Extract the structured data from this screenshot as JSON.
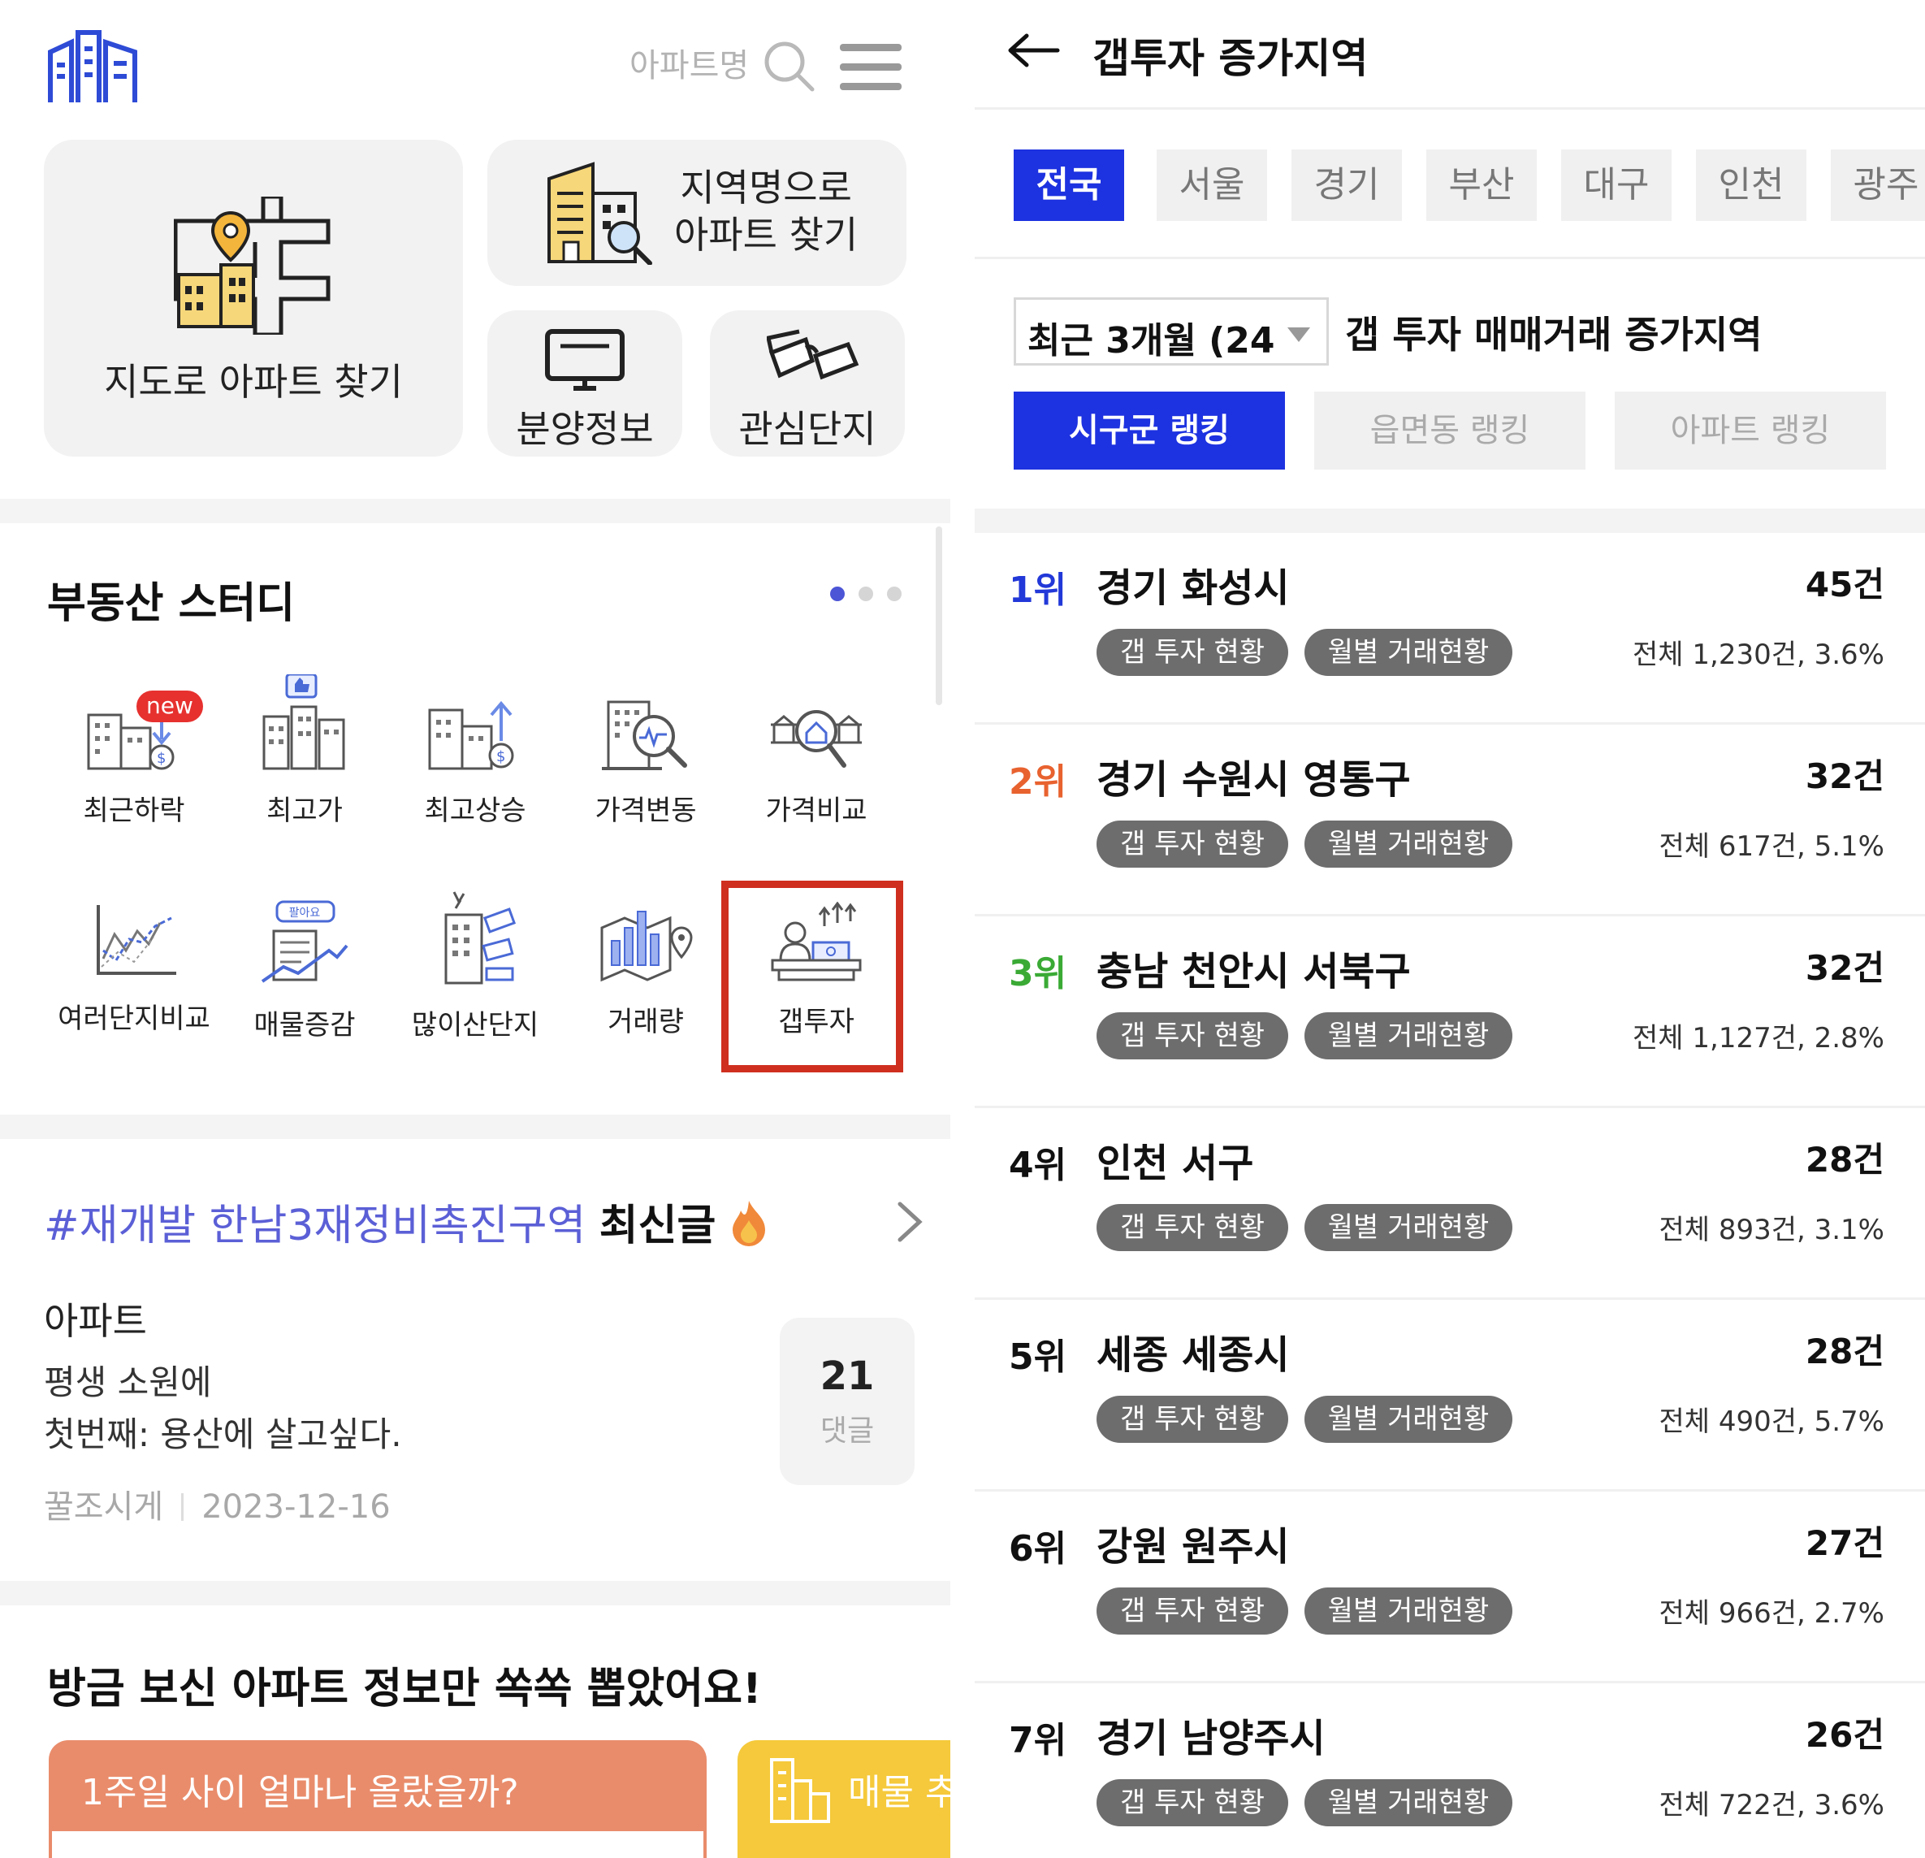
{
  "left": {
    "header": {
      "search_label": "아파트명"
    },
    "cards": {
      "map_label": "지도로 아파트 찾기",
      "region_label_1": "지역명으로",
      "region_label_2": "아파트 찾기",
      "sale_label": "분양정보",
      "favorite_label": "관심단지"
    },
    "study": {
      "title": "부동산 스터디",
      "new_badge": "new",
      "items": [
        {
          "label": "최근하락",
          "icon": "building-dollar-down-icon"
        },
        {
          "label": "최고가",
          "icon": "building-thumbs-up-icon"
        },
        {
          "label": "최고상승",
          "icon": "building-dollar-up-icon"
        },
        {
          "label": "가격변동",
          "icon": "building-magnifier-icon"
        },
        {
          "label": "가격비교",
          "icon": "house-compare-icon"
        },
        {
          "label": "여러단지비교",
          "icon": "line-chart-icon"
        },
        {
          "label": "매물증감",
          "icon": "listing-trend-icon"
        },
        {
          "label": "많이산단지",
          "icon": "building-money-icon"
        },
        {
          "label": "거래량",
          "icon": "map-bar-chart-icon"
        },
        {
          "label": "갭투자",
          "icon": "investor-desk-icon"
        }
      ],
      "badge_small": "팔아요"
    },
    "post": {
      "tag": "#재개발 한남3재정비촉진구역",
      "tag_suffix": "최신글",
      "category": "아파트",
      "line1": "평생 소원에",
      "line2": "첫번째: 용산에 살고싶다.",
      "author": "꿀조시게",
      "date": "2023-12-16",
      "comment_count": "21",
      "comment_label": "댓글"
    },
    "extract": {
      "title": "방금 보신 아파트 정보만 쏙쏙 뽑았어요!",
      "promo1": "1주일 사이 얼마나 올랐을까?",
      "promo2": "매물 추"
    }
  },
  "right": {
    "title": "갭투자 증가지역",
    "tabs": [
      "전국",
      "서울",
      "경기",
      "부산",
      "대구",
      "인천",
      "광주"
    ],
    "active_tab": "전국",
    "period_value": "최근 3개월 (24",
    "period_title": "갭 투자 매매거래 증가지역",
    "ranking_buttons": [
      "시구군 랭킹",
      "읍면동 랭킹",
      "아파트 랭킹"
    ],
    "chip_labels": {
      "gap": "갭 투자 현황",
      "monthly": "월별 거래현황"
    },
    "rows": [
      {
        "rank": "1위",
        "region": "경기 화성시",
        "count": "45건",
        "total": "전체 1,230건, 3.6%",
        "rank_color": "#2238d8"
      },
      {
        "rank": "2위",
        "region": "경기 수원시 영통구",
        "count": "32건",
        "total": "전체 617건, 5.1%",
        "rank_color": "#e8622f"
      },
      {
        "rank": "3위",
        "region": "충남 천안시 서북구",
        "count": "32건",
        "total": "전체 1,127건, 2.8%",
        "rank_color": "#3aaa35"
      },
      {
        "rank": "4위",
        "region": "인천 서구",
        "count": "28건",
        "total": "전체 893건, 3.1%",
        "rank_color": "#111111"
      },
      {
        "rank": "5위",
        "region": "세종 세종시",
        "count": "28건",
        "total": "전체 490건, 5.7%",
        "rank_color": "#111111"
      },
      {
        "rank": "6위",
        "region": "강원 원주시",
        "count": "27건",
        "total": "전체 966건, 2.7%",
        "rank_color": "#111111"
      },
      {
        "rank": "7위",
        "region": "경기 남양주시",
        "count": "26건",
        "total": "전체 722건, 3.6%",
        "rank_color": "#111111"
      }
    ],
    "colors": {
      "accent": "#1d32e0",
      "chip": "#6d6d6d"
    }
  }
}
